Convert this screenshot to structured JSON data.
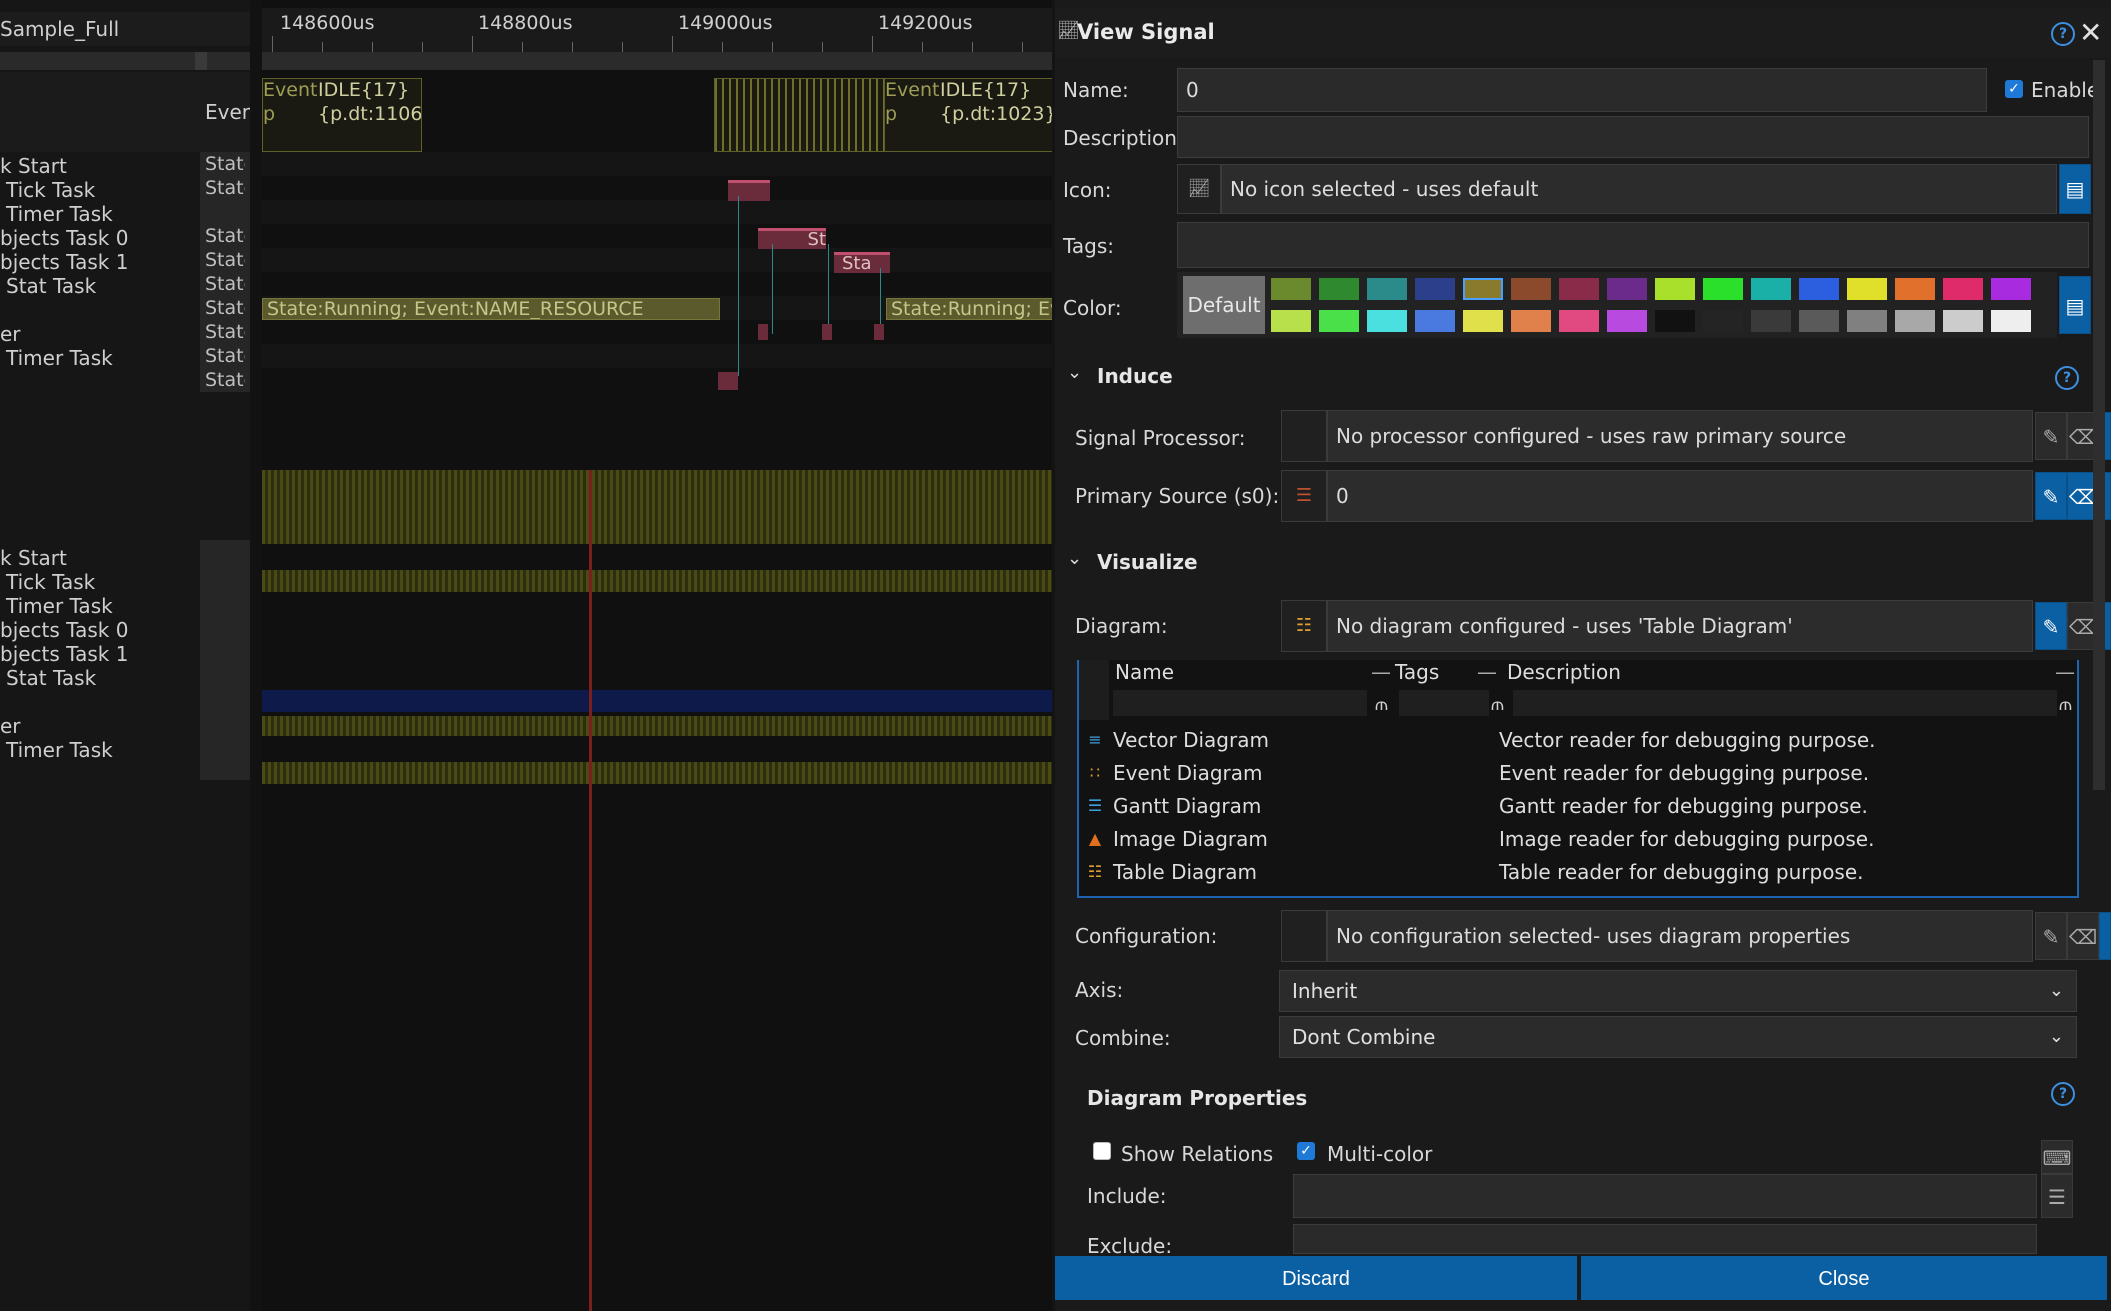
{
  "left": {
    "track_title": "Sample_Full",
    "event_col_label": "Ever",
    "group1_names": [
      "k Start",
      "Tick Task",
      "Timer Task",
      "bjects Task 0",
      "bjects Task 1",
      "Stat Task",
      "er",
      "Timer Task"
    ],
    "stat_labels": [
      "State",
      "State",
      "State",
      "State",
      "State",
      "State",
      "State",
      "State",
      "State"
    ],
    "group2_names": [
      "k Start",
      "Tick Task",
      "Timer Task",
      "bjects Task 0",
      "bjects Task 1",
      "Stat Task",
      "er",
      "Timer Task"
    ],
    "ruler_ticks": [
      "148600us",
      "148800us",
      "149000us",
      "149200us"
    ],
    "event_box1": {
      "prefix": "Event",
      "prefix2": "p",
      "line1": "IDLE{17}",
      "line2": "{p.dt:1106}"
    },
    "event_box2": {
      "prefix": "Event",
      "prefix2": "p",
      "line1": "IDLE{17}",
      "line2": "{p.dt:1023}"
    },
    "running_label_1": "State:Running; Event:NAME_RESOURCE",
    "running_label_2": "State:Running; Eve",
    "bar_label_st": "St",
    "bar_label_sta": "Sta"
  },
  "panel": {
    "title": "View Signal",
    "name_label": "Name:",
    "name_value": "0",
    "enable_label": "Enable",
    "description_label": "Description:",
    "description_value": "",
    "icon_label": "Icon:",
    "icon_value": "No icon selected - uses default",
    "tags_label": "Tags:",
    "tags_value": "",
    "color_label": "Color:",
    "color_default": "Default",
    "swatches_row1": [
      "#6b8a2e",
      "#2f8a2f",
      "#2b8a8a",
      "#2b3f8a",
      "#8a7a2b",
      "#8a4a2b",
      "#8a2b4a",
      "#6b2b8a",
      "#a8e02b",
      "#2be02b",
      "#1ab0a8",
      "#2b5fe0",
      "#e0e02b",
      "#e0702b",
      "#e02b6b",
      "#a82be0"
    ],
    "swatches_row2": [
      "#b8e04a",
      "#4ae04a",
      "#4ae0e0",
      "#4a7ae0",
      "#e0e04a",
      "#e0804a",
      "#e04a80",
      "#b84ae0",
      "#111111",
      "#242424",
      "#3a3a3a",
      "#5a5a5a",
      "#808080",
      "#a8a8a8",
      "#cccccc",
      "#eeeeee"
    ],
    "induce_label": "Induce",
    "signal_processor_label": "Signal Processor:",
    "signal_processor_value": "No processor configured - uses raw primary source",
    "primary_source_label": "Primary Source (s0):",
    "primary_source_value": "0",
    "visualize_label": "Visualize",
    "diagram_label": "Diagram:",
    "diagram_value": "No diagram configured - uses 'Table Diagram'",
    "table_headers": {
      "name": "Name",
      "tags": "Tags",
      "description": "Description"
    },
    "diagrams": [
      {
        "name": "Vector Diagram",
        "desc": "Vector reader for debugging purpose.",
        "icon": "vector-diagram-icon",
        "color": "#3da0e0"
      },
      {
        "name": "Event Diagram",
        "desc": "Event reader for debugging purpose.",
        "icon": "event-diagram-icon",
        "color": "#e0a030"
      },
      {
        "name": "Gantt Diagram",
        "desc": "Gantt reader for debugging purpose.",
        "icon": "gantt-diagram-icon",
        "color": "#3da0e0"
      },
      {
        "name": "Image Diagram",
        "desc": "Image reader for debugging purpose.",
        "icon": "image-diagram-icon",
        "color": "#e07020"
      },
      {
        "name": "Table Diagram",
        "desc": "Table reader for debugging purpose.",
        "icon": "table-diagram-icon",
        "color": "#e0a030"
      }
    ],
    "configuration_label": "Configuration:",
    "configuration_value": "No configuration selected- uses diagram properties",
    "axis_label": "Axis:",
    "axis_value": "Inherit",
    "combine_label": "Combine:",
    "combine_value": "Dont Combine",
    "diagram_properties_label": "Diagram Properties",
    "show_relations_label": "Show Relations",
    "multicolor_label": "Multi-color",
    "include_label": "Include:",
    "exclude_label": "Exclude:",
    "discard_label": "Discard",
    "close_label": "Close"
  }
}
